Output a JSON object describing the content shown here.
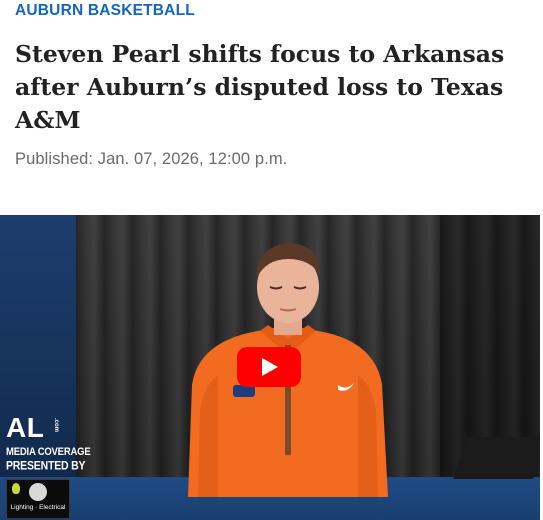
{
  "section": {
    "label": "AUBURN BASKETBALL"
  },
  "article": {
    "headline": "Steven Pearl shifts focus to Arkansas after Auburn’s disputed loss to Texas A&M",
    "published": "Published: Jan. 07, 2026, 12:00 p.m."
  },
  "video": {
    "overlay": {
      "brand": "AL",
      "brand_suffix": ".com",
      "line1": "MEDIA COVERAGE",
      "line2": "PRESENTED BY",
      "sponsor_name": "Lighting · Electrical"
    },
    "play_icon": "play-icon"
  },
  "colors": {
    "section_blue": "#1565c0",
    "headline": "#222222",
    "meta_gray": "#6b6b6b",
    "play_red": "#ff0000",
    "jacket_orange": "#f26b21"
  }
}
